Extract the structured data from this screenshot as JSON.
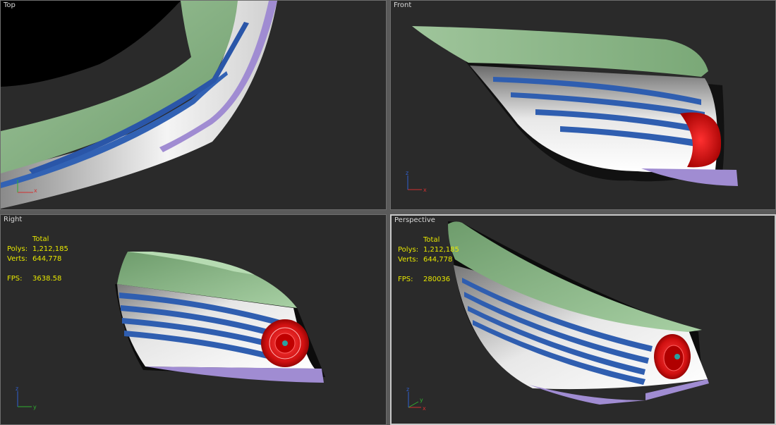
{
  "viewports": {
    "top": {
      "label": "Top"
    },
    "front": {
      "label": "Front"
    },
    "right": {
      "label": "Right",
      "stats_header": "Total",
      "polys_label": "Polys:",
      "polys": "1,212,185",
      "verts_label": "Verts:",
      "verts": "644,778",
      "fps_label": "FPS:",
      "fps": "3638.58"
    },
    "perspective": {
      "label": "Perspective",
      "stats_header": "Total",
      "polys_label": "Polys:",
      "polys": "1,212,185",
      "verts_label": "Verts:",
      "verts": "644,778",
      "fps_label": "FPS:",
      "fps": "280036"
    }
  },
  "gizmo_axes": {
    "x": "x",
    "y": "y",
    "z": "z"
  },
  "colors": {
    "viewport_bg": "#2a2a2a",
    "frame": "#5a5a5a",
    "stats": "#e8e800",
    "green_panel": "#8fb88c",
    "blue_slat": "#3262b4",
    "lilac_trim": "#a08cd2",
    "red_light": "#e01a1a",
    "body_white": "#e6e6e6"
  },
  "icons": [
    "axis-gizmo-icon"
  ]
}
